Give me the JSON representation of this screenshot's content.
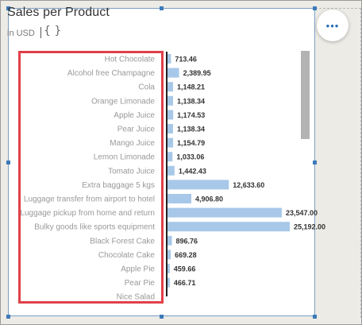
{
  "widget": {
    "title": "Sales per Product",
    "currency_label": "in USD",
    "braces_glyph": "{ }",
    "more_glyph": "•••",
    "colors": {
      "bar": "#a7c8e8",
      "axis": "#222222",
      "category_label": "#999999",
      "value_label": "#333333",
      "highlight": "#e0404a",
      "accent": "#2a6cb3"
    }
  },
  "chart_data": {
    "type": "bar",
    "orientation": "horizontal",
    "title": "Sales per Product",
    "subtitle": "in USD",
    "categories": [
      "Hot Chocolate",
      "Alcohol free Champagne",
      "Cola",
      "Orange Limonade",
      "Apple Juice",
      "Pear Juice",
      "Mango Juice",
      "Lemon Limonade",
      "Tomato Juice",
      "Extra baggage 5 kgs",
      "Luggage transfer from airport to hotel",
      "Luggage pickup from home and return",
      "Bulky goods like sports equipment",
      "Black Forest Cake",
      "Chocolate Cake",
      "Apple Pie",
      "Pear Pie",
      "Nice Salad"
    ],
    "values": [
      713.46,
      2389.95,
      1148.21,
      1138.34,
      1174.53,
      1138.34,
      1154.79,
      1033.06,
      1442.43,
      12633.6,
      4906.8,
      23547.0,
      25192.0,
      896.76,
      669.28,
      459.66,
      466.71,
      null
    ],
    "value_labels": [
      "713.46",
      "2,389.95",
      "1,148.21",
      "1,138.34",
      "1,174.53",
      "1,138.34",
      "1,154.79",
      "1,033.06",
      "1,442.43",
      "12,633.60",
      "4,906.80",
      "23,547.00",
      "25,192.00",
      "896.76",
      "669.28",
      "459.66",
      "466.71",
      ""
    ],
    "xlim": [
      0,
      25192.0
    ],
    "grid": false,
    "legend": "none"
  }
}
